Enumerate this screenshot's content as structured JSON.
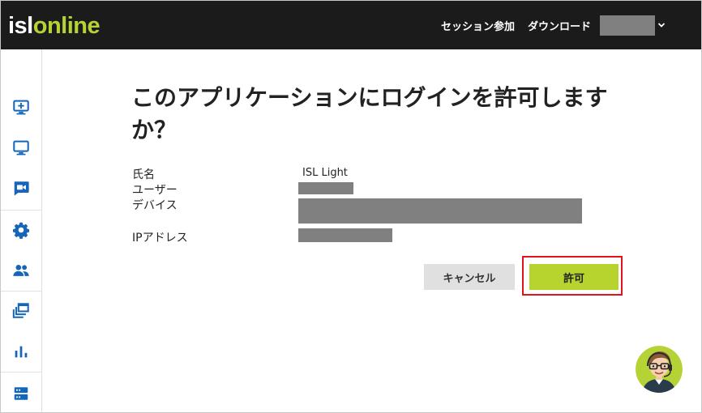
{
  "header": {
    "logo_part1": "isl",
    "logo_part2": "online",
    "nav_session": "セッション参加",
    "nav_download": "ダウンロード",
    "user_name_redacted": true
  },
  "sidebar": {
    "items": [
      {
        "icon": "add-screen-icon"
      },
      {
        "icon": "monitor-icon"
      },
      {
        "icon": "video-icon"
      },
      {
        "icon": "gear-icon"
      },
      {
        "icon": "users-icon"
      },
      {
        "icon": "windows-stack-icon"
      },
      {
        "icon": "bar-chart-icon"
      },
      {
        "icon": "server-icon"
      }
    ]
  },
  "main": {
    "title": "このアプリケーションにログインを許可しますか？",
    "fields": [
      {
        "label": "氏名",
        "value": "ISL Light"
      },
      {
        "label": "ユーザー",
        "value_redacted": true
      },
      {
        "label": "デバイス",
        "value_redacted": true
      },
      {
        "label": "IPアドレス",
        "value_redacted": true
      }
    ],
    "cancel_label": "キャンセル",
    "allow_label": "許可"
  },
  "colors": {
    "topbar": "#1b1b1b",
    "brand_green": "#b5d334",
    "sidebar_icon": "#1566b8",
    "highlight": "#e0141e",
    "redaction": "#808080"
  }
}
